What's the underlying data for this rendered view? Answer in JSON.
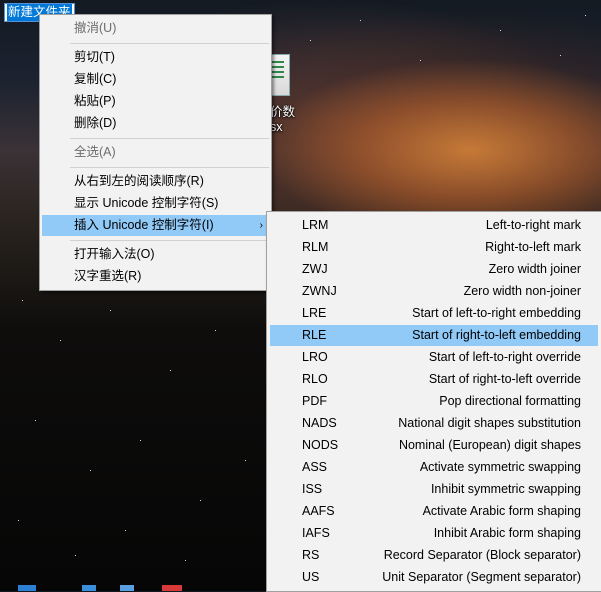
{
  "rename": {
    "text": "新建文件夹"
  },
  "desktop_icon": {
    "label": "价数\nsx",
    "label_line1": "价数",
    "label_line2": "sx"
  },
  "context_menu": {
    "items": [
      {
        "label": "撤消(U)",
        "disabled": true
      },
      {
        "label": "剪切(T)"
      },
      {
        "label": "复制(C)"
      },
      {
        "label": "粘贴(P)"
      },
      {
        "label": "删除(D)"
      },
      {
        "label": "全选(A)",
        "disabled": true
      },
      {
        "label": "从右到左的阅读顺序(R)"
      },
      {
        "label": "显示 Unicode 控制字符(S)"
      },
      {
        "label": "插入 Unicode 控制字符(I)",
        "highlighted": true,
        "submenu_arrow": "›"
      },
      {
        "label": "打开输入法(O)"
      },
      {
        "label": "汉字重选(R)"
      }
    ]
  },
  "submenu": {
    "items": [
      {
        "code": "LRM",
        "desc": "Left-to-right mark"
      },
      {
        "code": "RLM",
        "desc": "Right-to-left mark"
      },
      {
        "code": "ZWJ",
        "desc": "Zero width joiner"
      },
      {
        "code": "ZWNJ",
        "desc": "Zero width non-joiner"
      },
      {
        "code": "LRE",
        "desc": "Start of left-to-right embedding"
      },
      {
        "code": "RLE",
        "desc": "Start of right-to-left embedding",
        "highlighted": true
      },
      {
        "code": "LRO",
        "desc": "Start of left-to-right override"
      },
      {
        "code": "RLO",
        "desc": "Start of right-to-left override"
      },
      {
        "code": "PDF",
        "desc": "Pop directional formatting"
      },
      {
        "code": "NADS",
        "desc": "National digit shapes substitution"
      },
      {
        "code": "NODS",
        "desc": "Nominal (European) digit shapes"
      },
      {
        "code": "ASS",
        "desc": "Activate symmetric swapping"
      },
      {
        "code": "ISS",
        "desc": "Inhibit symmetric swapping"
      },
      {
        "code": "AAFS",
        "desc": "Activate Arabic form shaping"
      },
      {
        "code": "IAFS",
        "desc": "Inhibit Arabic form shaping"
      },
      {
        "code": "RS",
        "desc": "Record Separator (Block separator)"
      },
      {
        "code": "US",
        "desc": "Unit Separator (Segment separator)"
      }
    ]
  },
  "colors": {
    "menu_bg": "#f2f2f2",
    "highlight": "#91c9f7",
    "selection": "#0078d7",
    "disabled_text": "#6d6d6d"
  }
}
